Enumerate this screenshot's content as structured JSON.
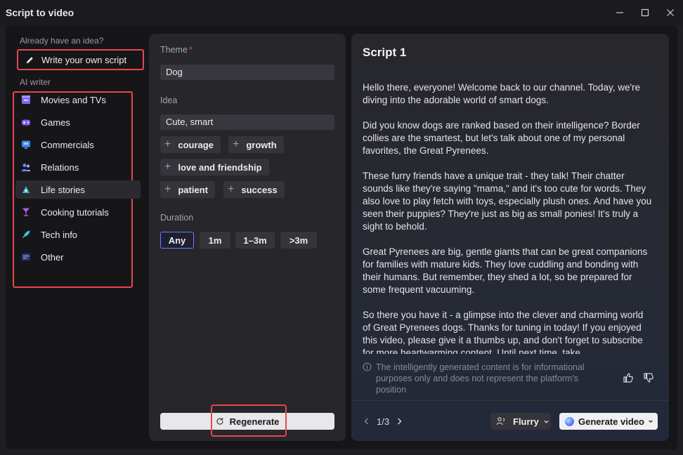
{
  "window": {
    "title": "Script to video"
  },
  "sidebar": {
    "heading_idea": "Already have an idea?",
    "write_own": "Write your own script",
    "heading_ai": "AI writer",
    "items": [
      {
        "label": "Movies and TVs",
        "icon": "clapperboard-icon",
        "color": "#7b6cf6"
      },
      {
        "label": "Games",
        "icon": "gamepad-icon",
        "color": "#8e5cf0"
      },
      {
        "label": "Commercials",
        "icon": "monitor-icon",
        "color": "#3d8de8"
      },
      {
        "label": "Relations",
        "icon": "people-icon",
        "color": "#6c7ff2"
      },
      {
        "label": "Life stories",
        "icon": "life-icon",
        "color": "#2fb6c9"
      },
      {
        "label": "Cooking tutorials",
        "icon": "glass-icon",
        "color": "#b45ee6"
      },
      {
        "label": "Tech info",
        "icon": "rocket-icon",
        "color": "#2fc7d6"
      },
      {
        "label": "Other",
        "icon": "list-icon",
        "color": "#4a66c8"
      }
    ],
    "active_index": 4
  },
  "form": {
    "theme_label": "Theme",
    "required_mark": "*",
    "theme_value": "Dog",
    "idea_label": "Idea",
    "idea_value": "Cute, smart",
    "tags": [
      "courage",
      "growth",
      "love and friendship",
      "patient",
      "success"
    ],
    "duration_label": "Duration",
    "durations": [
      "Any",
      "1m",
      "1–3m",
      ">3m"
    ],
    "duration_selected": "Any",
    "regenerate": "Regenerate"
  },
  "script": {
    "title": "Script 1",
    "paragraphs": [
      "Hello there, everyone! Welcome back to our channel. Today, we're diving into the adorable world of smart dogs.",
      "Did you know dogs are ranked based on their intelligence? Border collies are the smartest, but let's talk about one of my personal favorites, the Great Pyrenees.",
      "These furry friends have a unique trait - they talk! Their chatter sounds like they're saying \"mama,\" and it's too cute for words. They also love to play fetch with toys, especially plush ones. And have you seen their puppies? They're just as big as small ponies! It's truly a sight to behold.",
      "Great Pyrenees are big, gentle giants that can be great companions for families with mature kids. They love cuddling and bonding with their humans. But remember, they shed a lot, so be prepared for some frequent vacuuming.",
      "So there you have it - a glimpse into the clever and charming world of Great Pyrenees dogs. Thanks for tuning in today! If you enjoyed this video, please give it a thumbs up, and don't forget to subscribe for more heartwarming content. Until next time, take"
    ],
    "disclaimer": "The intelligently generated content is for informational purposes only and does not represent the platform's position",
    "pager": "1/3",
    "voice": "Flurry",
    "generate": "Generate video"
  }
}
